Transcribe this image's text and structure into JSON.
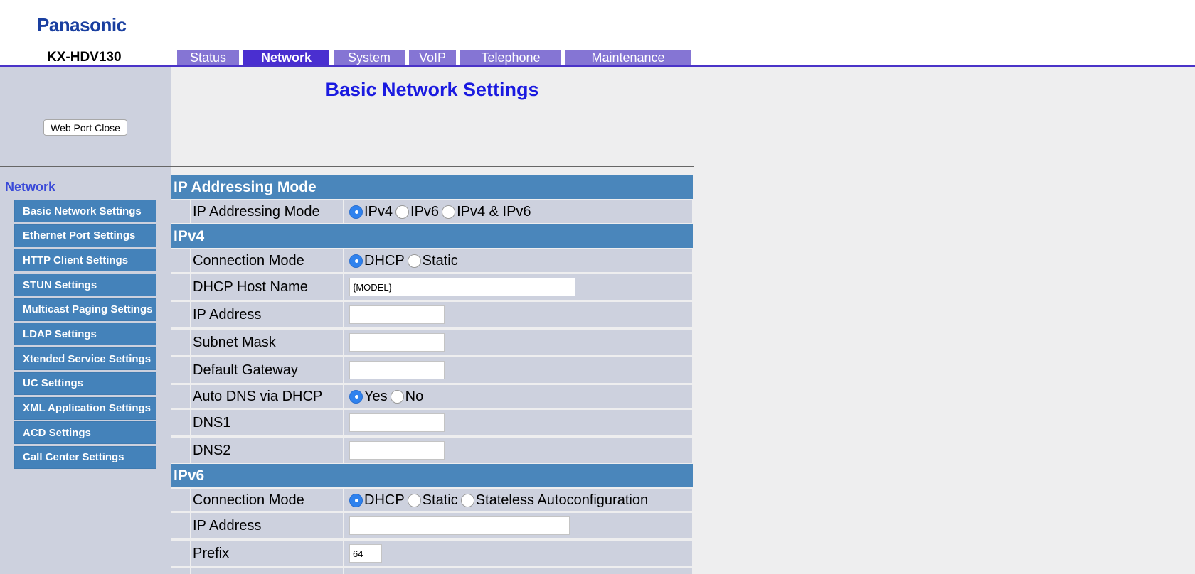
{
  "header": {
    "logo": "Panasonic",
    "model": "KX-HDV130",
    "tabs": [
      {
        "label": "Status",
        "active": false
      },
      {
        "label": "Network",
        "active": true
      },
      {
        "label": "System",
        "active": false
      },
      {
        "label": "VoIP",
        "active": false
      },
      {
        "label": "Telephone",
        "active": false
      },
      {
        "label": "Maintenance",
        "active": false
      }
    ]
  },
  "left": {
    "web_port_close": "Web Port Close",
    "nav_title": "Network",
    "nav_items": [
      "Basic Network Settings",
      "Ethernet Port Settings",
      "HTTP Client Settings",
      "STUN Settings",
      "Multicast Paging Settings",
      "LDAP Settings",
      "Xtended Service Settings",
      "UC Settings",
      "XML Application Settings",
      "ACD Settings",
      "Call Center Settings"
    ]
  },
  "main": {
    "title": "Basic Network Settings",
    "ip_mode_section": "IP Addressing Mode",
    "ip_mode": {
      "label": "IP Addressing Mode",
      "options": [
        "IPv4",
        "IPv6",
        "IPv4 & IPv6"
      ],
      "selected": "IPv4"
    },
    "ipv4_section": "IPv4",
    "ipv4": {
      "connection_mode": {
        "label": "Connection Mode",
        "options": [
          "DHCP",
          "Static"
        ],
        "selected": "DHCP"
      },
      "dhcp_host_name": {
        "label": "DHCP Host Name",
        "value": "{MODEL}"
      },
      "ip_address": {
        "label": "IP Address",
        "value": ""
      },
      "subnet_mask": {
        "label": "Subnet Mask",
        "value": ""
      },
      "default_gateway": {
        "label": "Default Gateway",
        "value": ""
      },
      "auto_dns": {
        "label": "Auto DNS via DHCP",
        "options": [
          "Yes",
          "No"
        ],
        "selected": "Yes"
      },
      "dns1": {
        "label": "DNS1",
        "value": ""
      },
      "dns2": {
        "label": "DNS2",
        "value": ""
      }
    },
    "ipv6_section": "IPv6",
    "ipv6": {
      "connection_mode": {
        "label": "Connection Mode",
        "options": [
          "DHCP",
          "Static",
          "Stateless Autoconfiguration"
        ],
        "selected": "DHCP"
      },
      "ip_address": {
        "label": "IP Address",
        "value": ""
      },
      "prefix": {
        "label": "Prefix",
        "value": "64"
      }
    }
  }
}
